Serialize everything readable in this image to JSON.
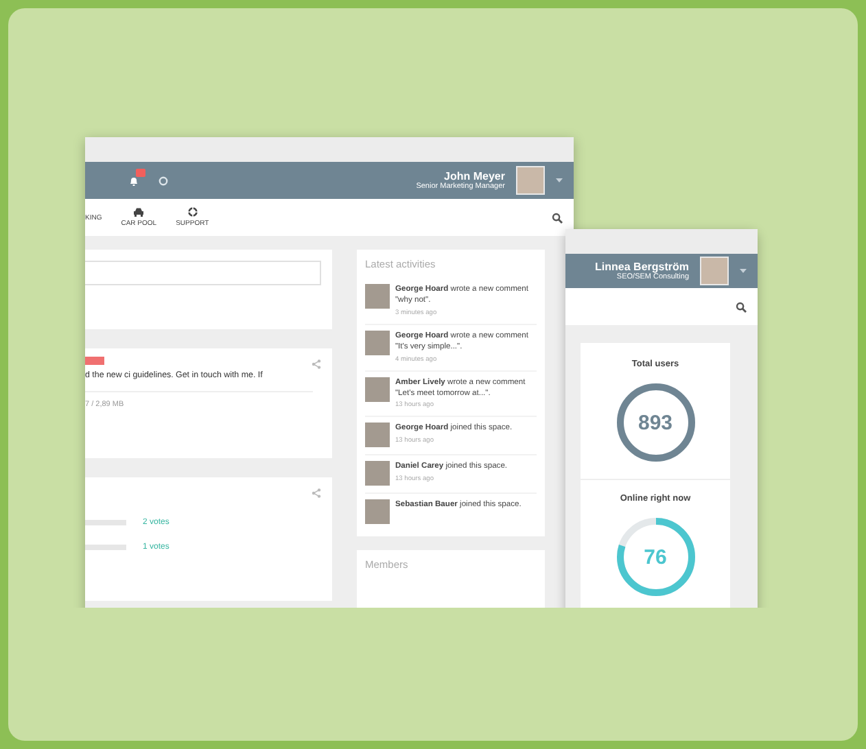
{
  "back_window": {
    "user": {
      "name": "John Meyer",
      "role": "Senior Marketing Manager"
    },
    "nav": [
      {
        "label": "KING",
        "kind": "plain"
      },
      {
        "label": "CAR POOL",
        "kind": "car"
      },
      {
        "label": "SUPPORT",
        "kind": "support"
      }
    ],
    "post": {
      "text": "d the new ci guidelines. Get in touch with me. If",
      "attachment": "7 / 2,89 MB"
    },
    "poll": [
      {
        "votes": "2 votes"
      },
      {
        "votes": "1 votes"
      }
    ],
    "activities_title": "Latest activities",
    "activities": [
      {
        "text": "**George Hoard** wrote a new comment \"why not\".",
        "time": "3 minutes ago"
      },
      {
        "text": "**George Hoard** wrote a new comment \"It's very simple...\".",
        "time": "4 minutes ago"
      },
      {
        "text": "**Amber Lively** wrote a new comment \"Let's meet tomorrow at...\".",
        "time": "13 hours ago"
      },
      {
        "text": "**George Hoard** joined this space.",
        "time": "13 hours ago"
      },
      {
        "text": "**Daniel Carey** joined this space.",
        "time": "13 hours ago"
      },
      {
        "text": "**Sebastian Bauer** joined this space."
      }
    ],
    "members_title": "Members"
  },
  "front_window": {
    "user": {
      "name": "Linnea Bergström",
      "role": "SEO/SEM Consulting"
    },
    "stats": [
      {
        "label": "Total users",
        "value": "893",
        "level": 1,
        "color": "#6f8593"
      },
      {
        "label": "Online right now",
        "value": "76",
        "level": 0.8,
        "color": "#4cc6cf"
      }
    ]
  }
}
